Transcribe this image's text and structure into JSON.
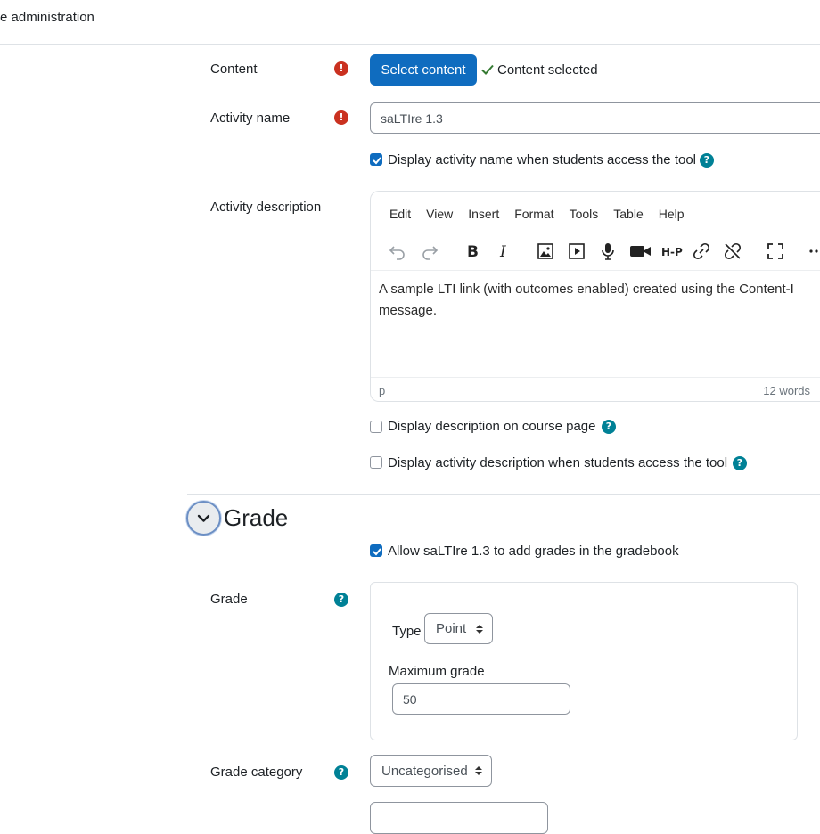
{
  "header": {
    "title": "e administration"
  },
  "content": {
    "label": "Content",
    "select_button": "Select content",
    "status": "Content selected"
  },
  "activity_name": {
    "label": "Activity name",
    "value": "saLTIre 1.3",
    "display_checkbox": {
      "label": "Display activity name when students access the tool",
      "checked": true
    }
  },
  "activity_description": {
    "label": "Activity description",
    "menubar": [
      "Edit",
      "View",
      "Insert",
      "Format",
      "Tools",
      "Table",
      "Help"
    ],
    "toolbar": [
      "undo-icon",
      "redo-icon",
      "bold-icon",
      "italic-icon",
      "image-icon",
      "media-icon",
      "microphone-icon",
      "video-camera-icon",
      "h5p-icon",
      "link-icon",
      "unlink-icon",
      "fullscreen-icon",
      "more-icon"
    ],
    "toolbar_h5p_text": "H-P",
    "text_line1": "A sample LTI link (with outcomes enabled) created using the Content-I",
    "text_line2": "message.",
    "status_path": "p",
    "word_count": "12 words",
    "show_on_course_page": {
      "label": "Display description on course page",
      "checked": false
    },
    "show_when_access": {
      "label": "Display activity description when students access the tool",
      "checked": false
    }
  },
  "grade_section": {
    "title": "Grade",
    "allow_grades": {
      "label": "Allow saLTIre 1.3 to add grades in the gradebook",
      "checked": true
    },
    "grade": {
      "label": "Grade",
      "type_label": "Type",
      "type_value": "Point",
      "max_label": "Maximum grade",
      "max_value": "50"
    },
    "category": {
      "label": "Grade category",
      "value": "Uncategorised"
    }
  },
  "colors": {
    "primary": "#0f6cbf",
    "required": "#ca3120",
    "help": "#008196",
    "success": "#357a32"
  }
}
